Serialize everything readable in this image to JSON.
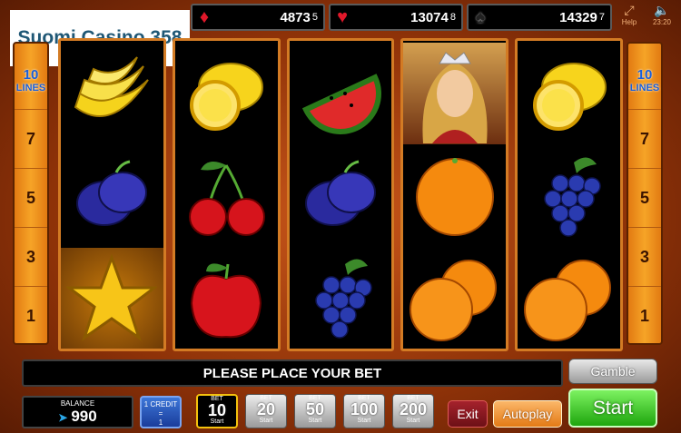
{
  "logo": "Suomi Casino 358",
  "jackpots": [
    {
      "suit": "diamond-icon",
      "glyph": "♦",
      "value": "4873",
      "sub": "5"
    },
    {
      "suit": "heart-icon",
      "glyph": "♥",
      "value": "13074",
      "sub": "8"
    },
    {
      "suit": "spade-icon",
      "glyph": "♠",
      "value": "14329",
      "sub": "7"
    }
  ],
  "top_icons": {
    "help_label": "Help",
    "clock": "23:20"
  },
  "lines": {
    "count": "10",
    "label": "LINES",
    "numbers": [
      "7",
      "5",
      "3",
      "1"
    ]
  },
  "reels": [
    [
      "banana",
      "plum",
      "star"
    ],
    [
      "lemon",
      "cherry",
      "apple"
    ],
    [
      "watermelon",
      "plum",
      "grapes"
    ],
    [
      "princess",
      "orange",
      "orange"
    ],
    [
      "lemon",
      "grapes",
      "orange"
    ]
  ],
  "message": "PLEASE PLACE YOUR BET",
  "gamble_label": "Gamble",
  "balance": {
    "label": "BALANCE",
    "value": "990"
  },
  "credit": {
    "label": "1 CREDIT",
    "eq": "=",
    "value": "1"
  },
  "bets": [
    {
      "head": "BET",
      "value": "10",
      "sub": "Start",
      "active": true
    },
    {
      "head": "BET",
      "value": "20",
      "sub": "Start",
      "active": false
    },
    {
      "head": "BET",
      "value": "50",
      "sub": "Start",
      "active": false
    },
    {
      "head": "BET",
      "value": "100",
      "sub": "Start",
      "active": false
    },
    {
      "head": "BET",
      "value": "200",
      "sub": "Start",
      "active": false
    }
  ],
  "exit_label": "Exit",
  "autoplay_label": "Autoplay",
  "start_label": "Start"
}
